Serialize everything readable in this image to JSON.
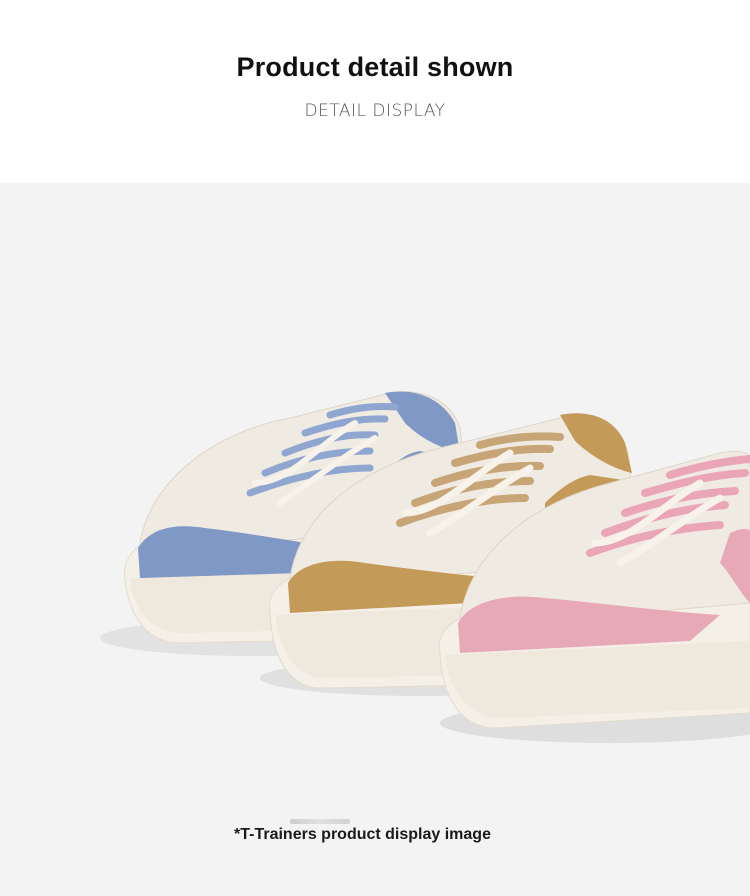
{
  "header": {
    "title": "Product detail shown",
    "subtitle": "DETAIL DISPLAY"
  },
  "photo": {
    "subject": "three-sneakers-icon",
    "colors": {
      "background": "#f3f3f3",
      "body": "#f1ece3",
      "sole": "#f4efe6",
      "blue_suede": "#7f98c6",
      "tan_suede": "#c49a58",
      "pink_suede": "#e8a9b6"
    }
  },
  "caption": "*T-Trainers product display image"
}
